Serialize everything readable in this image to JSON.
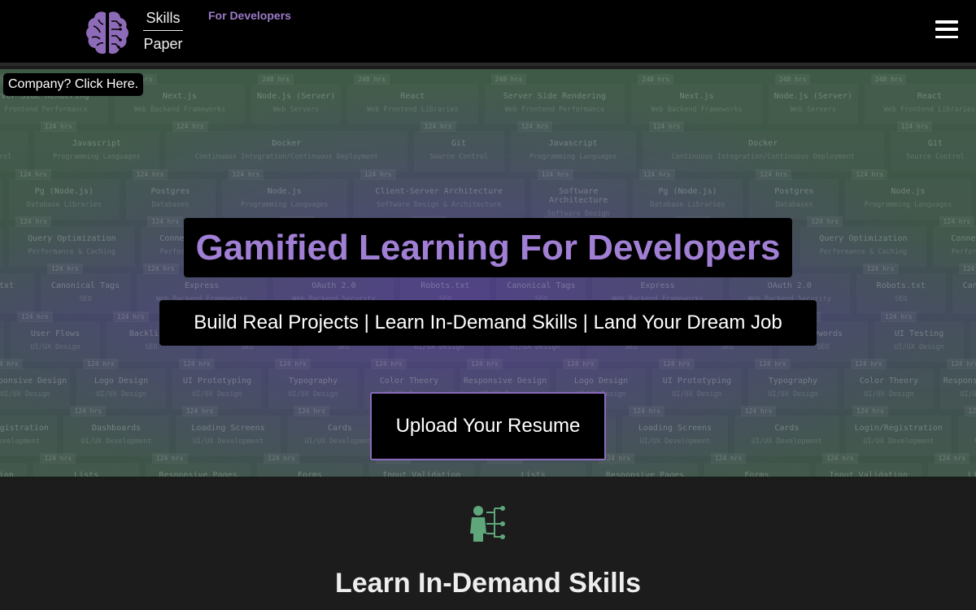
{
  "header": {
    "brand_line1": "Skills",
    "brand_line2": "Paper",
    "tagline": "For Developers",
    "logo_icon": "brain-circuit-icon",
    "menu_icon": "hamburger-icon",
    "brand_color": "#8e6bb8"
  },
  "hero": {
    "company_link": "Company? Click Here.",
    "title": "Gamified Learning For Developers",
    "subtitle": "Build Real Projects | Learn In-Demand Skills | Land Your Dream Job",
    "cta": "Upload Your Resume",
    "accent": "#a07fd4",
    "tile_rows": [
      [
        [
          "248 hrs",
          "Server Side Rendering",
          "Web Frontend Performance"
        ],
        [
          "248 hrs",
          "Next.js",
          "Web Backend Frameworks"
        ],
        [
          "248 hrs",
          "Node.js (Server)",
          "Web Servers"
        ],
        [
          "248 hrs",
          "React",
          "Web Frontend Libraries"
        ]
      ],
      [
        [
          "124 hrs",
          "Git",
          "Source Control"
        ],
        [
          "124 hrs",
          "Javascript",
          "Programming Languages"
        ],
        [
          "124 hrs",
          "Docker",
          "Continuous Integration/Continuous Deployment"
        ]
      ],
      [
        [
          "124 hrs",
          "Software Architecture",
          "Software Design"
        ],
        [
          "124 hrs",
          "Pg (Node.js)",
          "Database Libraries"
        ],
        [
          "124 hrs",
          "Postgres",
          "Databases"
        ],
        [
          "124 hrs",
          "Node.js",
          "Programming Languages"
        ],
        [
          "124 hrs",
          "Client-Server Architecture",
          "Software Design & Architecture"
        ]
      ],
      [
        [
          "124 hrs",
          "Asynchronous Processing",
          "Performance & Caching"
        ],
        [
          "124 hrs",
          "Query Optimization",
          "Performance & Caching"
        ],
        [
          "124 hrs",
          "Connection Pooling",
          "Performance & Caching"
        ]
      ],
      [
        [
          "124 hrs",
          "Robots.txt",
          "SEO"
        ],
        [
          "124 hrs",
          "Canonical Tags",
          "SEO"
        ],
        [
          "124 hrs",
          "Express",
          "Web Backend Frameworks"
        ],
        [
          "124 hrs",
          "OAuth 2.0",
          "Web Backend Security"
        ]
      ],
      [
        [
          "124 hrs",
          "UI Testing",
          "UI/UX Design"
        ],
        [
          "124 hrs",
          "User Flows",
          "UI/UX Design"
        ],
        [
          "124 hrs",
          "Backlinks",
          "SEO"
        ],
        [
          "124 hrs",
          "Sitemap",
          "SEO"
        ],
        [
          "124 hrs",
          "Keywords",
          "SEO"
        ]
      ],
      [
        [
          "124 hrs",
          "Color Theory",
          "UI/UX Design"
        ],
        [
          "124 hrs",
          "Responsive Design",
          "UI/UX Design"
        ],
        [
          "124 hrs",
          "Logo Design",
          "UI/UX Design"
        ],
        [
          "124 hrs",
          "UI Prototyping",
          "UI/UX Design"
        ],
        [
          "124 hrs",
          "Typography",
          "UI/UX Design"
        ]
      ],
      [
        [
          "124 hrs",
          "Login/Registration",
          "UI/UX Development"
        ],
        [
          "124 hrs",
          "Dashboards",
          "UI/UX Development"
        ],
        [
          "124 hrs",
          "Loading Screens",
          "UI/UX Development"
        ],
        [
          "124 hrs",
          "Cards",
          "UI/UX Development"
        ]
      ],
      [
        [
          "124 hrs",
          "Input Validation",
          "UI/UX Development"
        ],
        [
          "124 hrs",
          "Lists",
          "UI/UX Development"
        ],
        [
          "124 hrs",
          "Responsive Pages",
          "UI/UX Development"
        ],
        [
          "124 hrs",
          "Forms",
          "UI/UX Development"
        ]
      ]
    ]
  },
  "feature": {
    "icon": "person-skill-tree-icon",
    "icon_color": "#5fa77a",
    "title": "Learn In-Demand Skills"
  }
}
